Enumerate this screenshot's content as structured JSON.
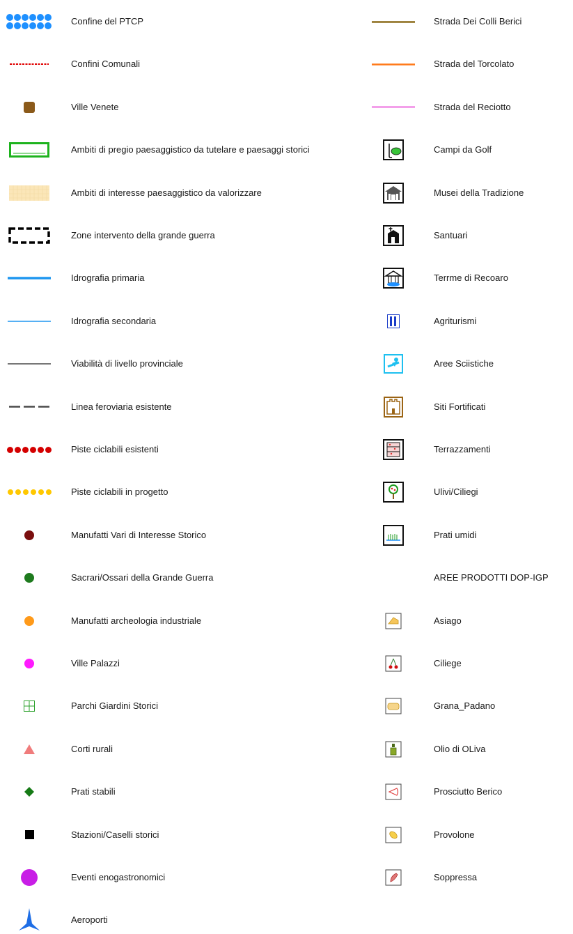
{
  "legend": {
    "left": [
      {
        "symbol": "dotted-blue-boundary",
        "label": "Confine del PTCP"
      },
      {
        "symbol": "red-dashed-line",
        "label": "Confini Comunali"
      },
      {
        "symbol": "brown-square",
        "label": "Ville Venete"
      },
      {
        "symbol": "green-rectangle-outline",
        "label": "Ambiti di pregio paesaggistico da tutelare e paesaggi storici"
      },
      {
        "symbol": "light-yellow-grid-fill",
        "label": "Ambiti di interesse paesaggistico da valorizzare"
      },
      {
        "symbol": "black-dashed-rectangle",
        "label": "Zone intervento della grande guerra"
      },
      {
        "symbol": "thick-blue-line",
        "label": "Idrografia primaria"
      },
      {
        "symbol": "thin-blue-line",
        "label": "Idrografia secondaria"
      },
      {
        "symbol": "thin-gray-line",
        "label": "Viabilità di livello provinciale"
      },
      {
        "symbol": "dashed-gray-line",
        "label": "Linea feroviaria esistente"
      },
      {
        "symbol": "red-dots-line",
        "label": "Piste ciclabili esistenti"
      },
      {
        "symbol": "yellow-dots-line",
        "label": "Piste ciclabili in progetto"
      },
      {
        "symbol": "dark-red-dot",
        "label": "Manufatti Vari di Interesse Storico"
      },
      {
        "symbol": "green-dot",
        "label": "Sacrari/Ossari della Grande Guerra"
      },
      {
        "symbol": "orange-dot",
        "label": "Manufatti archeologia industriale"
      },
      {
        "symbol": "magenta-dot",
        "label": "Ville Palazzi"
      },
      {
        "symbol": "green-grid-square",
        "label": "Parchi Giardini Storici"
      },
      {
        "symbol": "pink-triangle",
        "label": "Corti rurali"
      },
      {
        "symbol": "green-diamond",
        "label": "Prati stabili"
      },
      {
        "symbol": "black-square",
        "label": "Stazioni/Caselli storici"
      },
      {
        "symbol": "large-purple-dot",
        "label": "Eventi enogastronomici"
      },
      {
        "symbol": "airport-icon",
        "label": "Aeroporti"
      }
    ],
    "right": [
      {
        "symbol": "brown-line",
        "label": "Strada Dei Colli Berici"
      },
      {
        "symbol": "orange-line",
        "label": "Strada del Torcolato"
      },
      {
        "symbol": "pink-line",
        "label": "Strada del Reciotto"
      },
      {
        "symbol": "golf-icon",
        "label": "Campi da Golf"
      },
      {
        "symbol": "museum-icon",
        "label": "Musei della Tradizione"
      },
      {
        "symbol": "sanctuary-icon",
        "label": "Santuari"
      },
      {
        "symbol": "thermal-bath-icon",
        "label": "Terrme di Recoaro"
      },
      {
        "symbol": "agritourism-icon",
        "label": "Agriturismi"
      },
      {
        "symbol": "ski-icon",
        "label": "Aree Sciistiche"
      },
      {
        "symbol": "fortress-icon",
        "label": "Siti Fortificati"
      },
      {
        "symbol": "terrace-icon",
        "label": "Terrazzamenti"
      },
      {
        "symbol": "tree-icon",
        "label": "Ulivi/Ciliegi"
      },
      {
        "symbol": "wetland-icon",
        "label": "Prati umidi"
      }
    ],
    "dop_heading": "AREE PRODOTTI DOP-IGP",
    "dop": [
      {
        "symbol": "cheese-icon",
        "label": "Asiago"
      },
      {
        "symbol": "cherry-icon",
        "label": "Ciliege"
      },
      {
        "symbol": "grana-icon",
        "label": "Grana_Padano"
      },
      {
        "symbol": "olive-oil-icon",
        "label": "Olio di OLiva"
      },
      {
        "symbol": "ham-icon",
        "label": "Prosciutto Berico"
      },
      {
        "symbol": "provolone-icon",
        "label": "Provolone"
      },
      {
        "symbol": "salami-icon",
        "label": "Soppressa"
      }
    ]
  },
  "colors": {
    "ptcp_blue": "#1e90ff",
    "comuni_red": "#e00000",
    "villa_brown": "#8b5a1a",
    "pregio_green": "#1db31d",
    "interesse_fill": "#fbe6b8",
    "water_blue": "#1e96f0",
    "road_gray": "#4a4a4a",
    "bike_red": "#d40000",
    "bike_yellow": "#ffc800",
    "colli_berici": "#8b6b1a",
    "torcolato": "#ff7a1a",
    "reciotto": "#f08ce6"
  }
}
